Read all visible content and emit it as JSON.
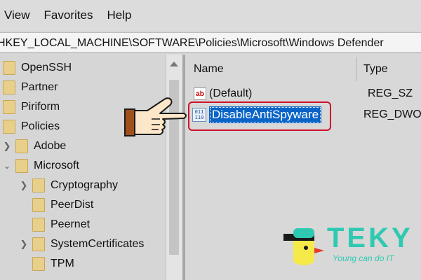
{
  "menu": {
    "items": [
      "View",
      "Favorites",
      "Help"
    ]
  },
  "address": {
    "path": "HKEY_LOCAL_MACHINE\\SOFTWARE\\Policies\\Microsoft\\Windows Defender"
  },
  "tree": {
    "items": [
      {
        "label": "OpenSSH"
      },
      {
        "label": "Partner"
      },
      {
        "label": "Piriform"
      },
      {
        "label": "Policies"
      },
      {
        "label": "Adobe"
      },
      {
        "label": "Microsoft"
      },
      {
        "label": "Cryptography"
      },
      {
        "label": "PeerDist"
      },
      {
        "label": "Peernet"
      },
      {
        "label": "SystemCertificates"
      },
      {
        "label": "TPM"
      }
    ]
  },
  "values_pane": {
    "columns": {
      "name": "Name",
      "type": "Type"
    },
    "rows": [
      {
        "name": "(Default)",
        "type": "REG_SZ",
        "icon": "string-value-icon"
      },
      {
        "name": "DisableAntiSpyware",
        "type": "REG_DWOR",
        "icon": "binary-value-icon"
      }
    ]
  },
  "icons": {
    "pointer": "pointing-hand-icon"
  },
  "branding": {
    "name": "TEKY",
    "tagline": "Young can do IT"
  },
  "colors": {
    "selection": "#0a64c8",
    "highlight_box": "#d0102a",
    "brand": "#2ec9b0",
    "brand_yellow": "#f5ea4a"
  }
}
